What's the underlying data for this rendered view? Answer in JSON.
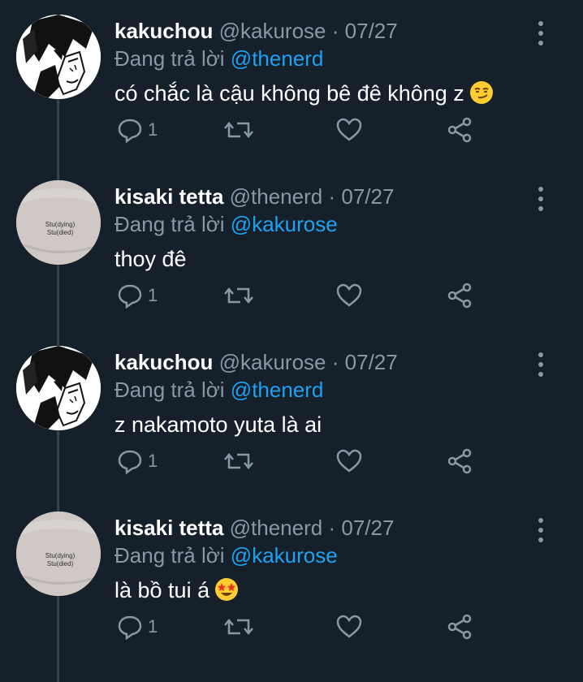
{
  "tweets": [
    {
      "name": "kakuchou",
      "handle": "@kakurose",
      "dot": "·",
      "date": "07/27",
      "reply_prefix": "Đang trả lời",
      "reply_to": "@thenerd",
      "text": "có chắc là cậu không bê đê không z",
      "emoji": "smirking-face",
      "reply_count": "1",
      "avatar": "manga-character-avatar"
    },
    {
      "name": "kisaki tetta",
      "handle": "@thenerd",
      "dot": "·",
      "date": "07/27",
      "reply_prefix": "Đang trả lời",
      "reply_to": "@kakurose",
      "text": "thoy đê",
      "emoji": "",
      "reply_count": "1",
      "avatar": "shirt-avatar",
      "avatar_text": [
        "Stu(dying)",
        "Stu(died)"
      ]
    },
    {
      "name": "kakuchou",
      "handle": "@kakurose",
      "dot": "·",
      "date": "07/27",
      "reply_prefix": "Đang trả lời",
      "reply_to": "@thenerd",
      "text": "z nakamoto yuta là ai",
      "emoji": "",
      "reply_count": "1",
      "avatar": "manga-character-avatar"
    },
    {
      "name": "kisaki tetta",
      "handle": "@thenerd",
      "dot": "·",
      "date": "07/27",
      "reply_prefix": "Đang trả lời",
      "reply_to": "@kakurose",
      "text": "là bồ tui á",
      "emoji": "star-struck",
      "reply_count": "1",
      "avatar": "shirt-avatar",
      "avatar_text": [
        "Stu(dying)",
        "Stu(died)"
      ]
    }
  ],
  "colors": {
    "background": "#15202b",
    "text": "#ffffff",
    "muted": "#8899a6",
    "mention": "#1da1f2",
    "thread_line": "#38444d"
  }
}
